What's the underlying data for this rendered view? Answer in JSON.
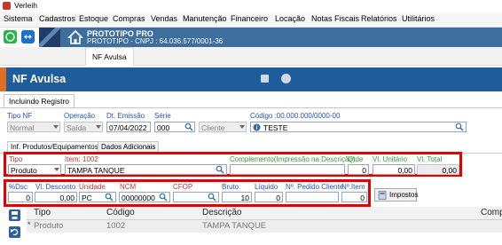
{
  "window": {
    "title": "Verleih"
  },
  "menu": [
    "Sistema",
    "Cadastros",
    "Estoque",
    "Compras",
    "Vendas",
    "Manutenção",
    "Financeiro",
    "Locação",
    "Notas Fiscais",
    "Relatórios",
    "Utilitários"
  ],
  "company": {
    "name": "PROTOTIPO PRO",
    "cnpj": "PROTOTIPO - CNPJ : 64.036.577/0001-36"
  },
  "doc_tab": "NF Avulsa",
  "form": {
    "title": "NF Avulsa",
    "state_tab": "Incluindo Registro",
    "tipo_nf": {
      "label": "Tipo NF",
      "value": "Normal"
    },
    "operacao": {
      "label": "Operação",
      "value": "Saída"
    },
    "dt_emissao": {
      "label": "Dt. Emissão",
      "value": "07/04/2022"
    },
    "serie": {
      "label": "Série",
      "value": "000"
    },
    "destinatario_tipo": {
      "value": "Cliente"
    },
    "codigo": {
      "label": "Código :00.000.000/0000-00",
      "value": "TESTE"
    },
    "tabs": [
      "Inf. Produtos/Equipamentos",
      "Dados Adicionais"
    ]
  },
  "item_row": {
    "tipo": {
      "label": "Tipo",
      "value": "Produto"
    },
    "item": {
      "label": "Item: 1002",
      "value": "TAMPA TANQUE"
    },
    "complemento": {
      "label": "Complemento(Impressão na Descrição)",
      "value": ""
    },
    "qtde": {
      "label": "Qtde",
      "value": "0"
    },
    "vl_unitario": {
      "label": "Vl. Unitário",
      "value": "0,00"
    },
    "vl_total": {
      "label": "Vl. Total",
      "value": "0,00"
    }
  },
  "detail_row": {
    "pct_dsc": {
      "label": "%Dsc",
      "value": "0"
    },
    "vl_desconto": {
      "label": "Vl. Desconto",
      "value": "0,00"
    },
    "unidade": {
      "label": "Unidade",
      "value": "PC"
    },
    "ncm": {
      "label": "NCM",
      "value": "00000000"
    },
    "cfop": {
      "label": "CFOP",
      "value": ""
    },
    "bruto": {
      "label": "Bruto",
      "value": "10"
    },
    "liquido": {
      "label": "Líquido",
      "value": "0"
    },
    "pedido_cliente": {
      "label": "Nº. Pedido Cliente",
      "value": ""
    },
    "n_item": {
      "label": "Nº.Item",
      "value": "0"
    },
    "impostos_button": "Impostos"
  },
  "grid": {
    "headers": [
      "Tipo",
      "Código",
      "Descrição",
      "Comp"
    ],
    "rows": [
      {
        "marker": "*",
        "tipo": "Produto",
        "codigo": "1002",
        "descricao": "TAMPA TANQUE"
      }
    ]
  },
  "colors": {
    "header_blue": "#1e5c9c",
    "accent_orange": "#e07020",
    "highlight_red": "#e30000",
    "label_blue": "#2456b3"
  }
}
